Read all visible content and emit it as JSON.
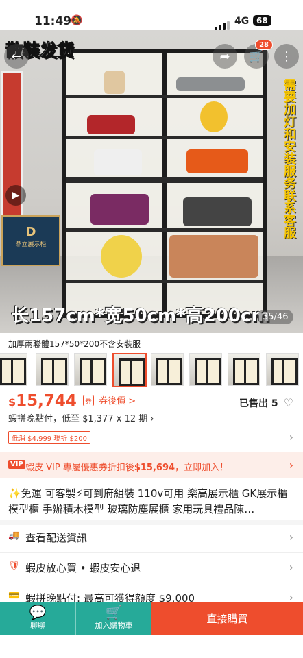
{
  "status": {
    "time": "11:49",
    "network": "4G",
    "battery": "68"
  },
  "hero": {
    "banner": "散裝发货",
    "side_text": "需要加灯和安装服务联系客服",
    "dimensions": "长157cm*宽50cm*高200cm",
    "counter": "35/46",
    "cart_badge": "28",
    "poster_logo_text": "鼎立展示柜"
  },
  "variant_label": "加厚兩聯體157*50*200不含安裝服",
  "price": {
    "currency": "$",
    "value": "15,744",
    "coupon_label": "券後價 >",
    "sold": "已售出 5",
    "installment": "蝦拼晚點付，低至 $1,377 x 12 期 ›",
    "promo_tag": "低消 $4,999 現折 $200"
  },
  "vip": {
    "icon": "VIP",
    "text_prefix": "蝦皮 VIP 專屬優惠券折扣後",
    "amount": "$15,694",
    "text_suffix": "，立即加入！"
  },
  "product_title": "✨免運 可客製⚡可到府組裝 110v可用 樂高展示櫃 GK展示櫃 模型櫃 手辦積木模型 玻璃防塵展櫃 家用玩具禮品陳…",
  "rows": [
    {
      "label": "查看配送資訊"
    },
    {
      "label": "蝦皮放心買 • 蝦皮安心退"
    },
    {
      "label": "蝦拼晚點付: 最高可獲得額度 $9,000"
    }
  ],
  "bottom": {
    "chat": "聊聊",
    "add_to_cart": "加入購物車",
    "buy_now": "直接購買"
  },
  "colors": {
    "brand": "#ee4d2d",
    "teal": "#26aa99"
  }
}
